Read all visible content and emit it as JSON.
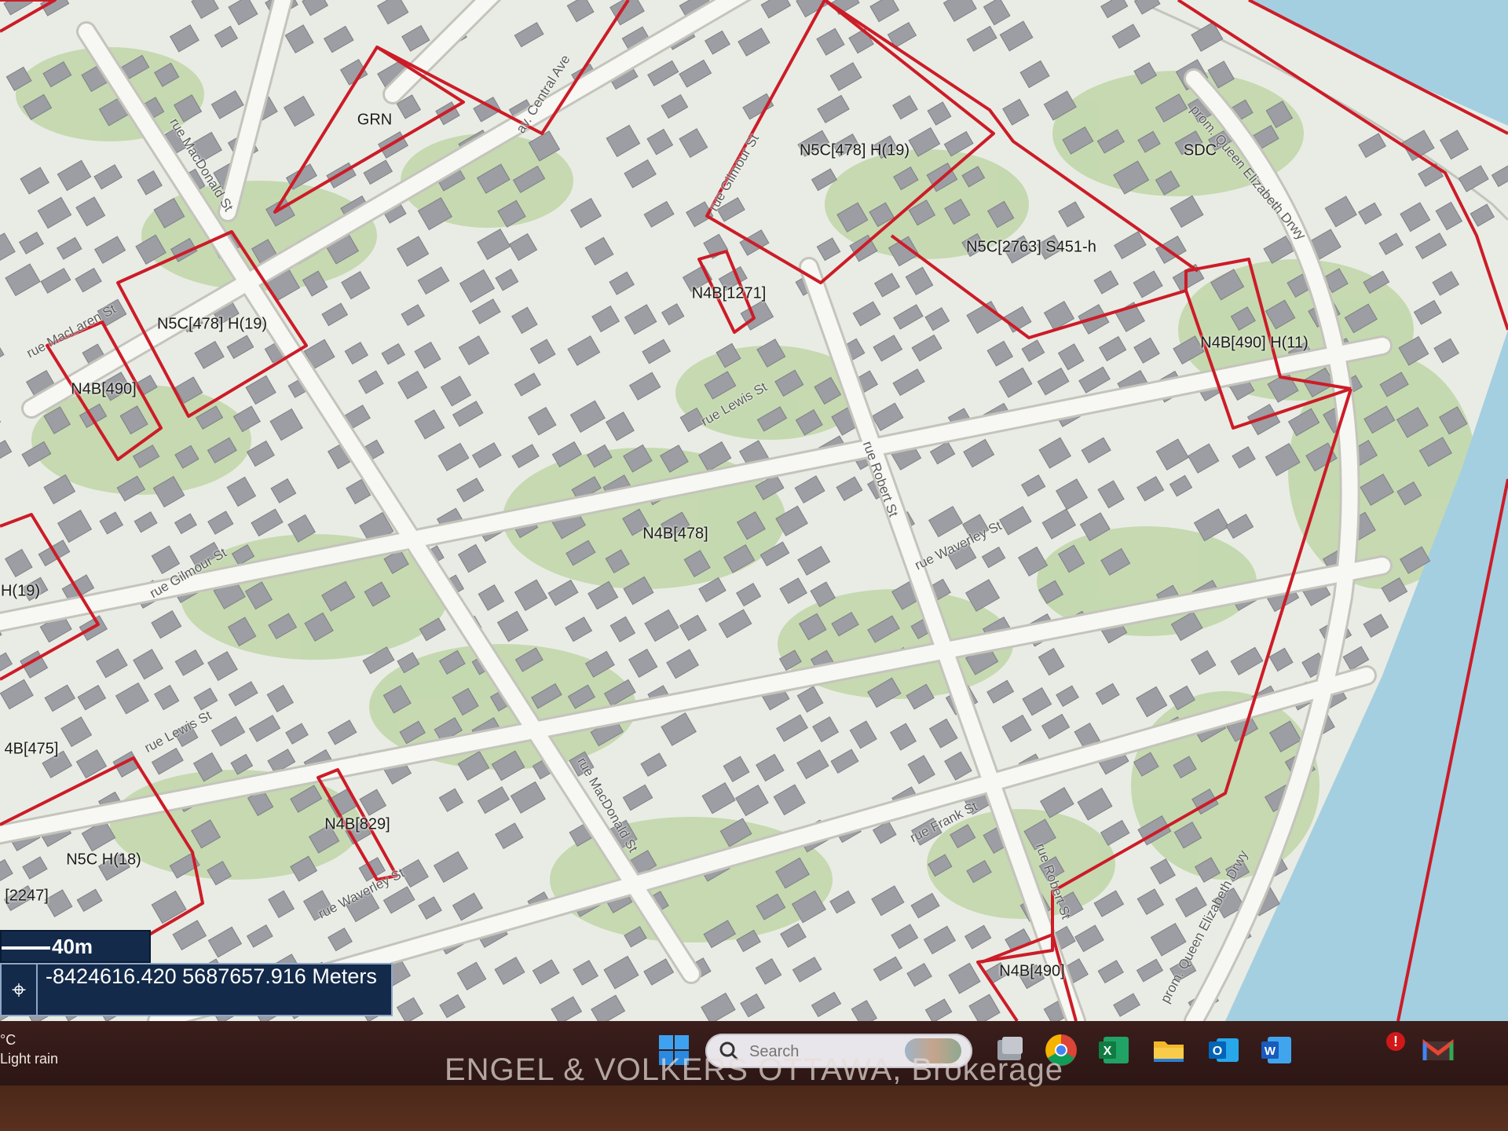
{
  "map": {
    "colors": {
      "land": "#e9ece4",
      "vegetation": "#bfd6a8",
      "building": "#9c9ea3",
      "road": "#f7f7f3",
      "road_edge": "#c4c4bc",
      "water": "#a4cfe0",
      "zone_line": "#cc1c28"
    },
    "zones": [
      {
        "label": "GRN"
      },
      {
        "label": "N5C[478] H(19)"
      },
      {
        "label": "SDC"
      },
      {
        "label": "N5C[2763] S451-h"
      },
      {
        "label": "N4B[1271]"
      },
      {
        "label": "N5C[478] H(19)"
      },
      {
        "label": "N4B[490]"
      },
      {
        "label": "N4B[490] H(11)"
      },
      {
        "label": "N4B[478]"
      },
      {
        "label": "H(19)"
      },
      {
        "label": "4B[475]"
      },
      {
        "label": "N4B[829]"
      },
      {
        "label": "N5C H(18)"
      },
      {
        "label": "[2247]"
      },
      {
        "label": "N4B[490]"
      }
    ],
    "streets": [
      {
        "label": "rue MacDonald St"
      },
      {
        "label": "rue MacLaren St"
      },
      {
        "label": "av. Central Ave"
      },
      {
        "label": "rue Gilmour St"
      },
      {
        "label": "prom. Queen Elizabeth Drwy"
      },
      {
        "label": "rue Lewis St"
      },
      {
        "label": "rue Robert St"
      },
      {
        "label": "rue Waverley St"
      },
      {
        "label": "rue Gilmour St"
      },
      {
        "label": "rue Lewis St"
      },
      {
        "label": "rue MacDonald St"
      },
      {
        "label": "rue Frank St"
      },
      {
        "label": "rue Waverley St"
      },
      {
        "label": "rue Robert St"
      },
      {
        "label": "prom. Queen Elizabeth Drwy"
      }
    ],
    "scale_label": "40m",
    "coordinates": "-8424616.420 5687657.916 Meters"
  },
  "taskbar": {
    "weather_temp": "°C",
    "weather_text": "Light rain",
    "search_placeholder": "Search",
    "apps": [
      {
        "name": "start-icon"
      },
      {
        "name": "task-view-icon"
      },
      {
        "name": "chrome-icon"
      },
      {
        "name": "excel-icon"
      },
      {
        "name": "file-explorer-icon"
      },
      {
        "name": "outlook-icon"
      },
      {
        "name": "word-icon"
      },
      {
        "name": "gmail-icon"
      }
    ],
    "notification_badge": "!"
  },
  "watermark": "ENGEL & VOLKERS OTTAWA, Brokerage"
}
